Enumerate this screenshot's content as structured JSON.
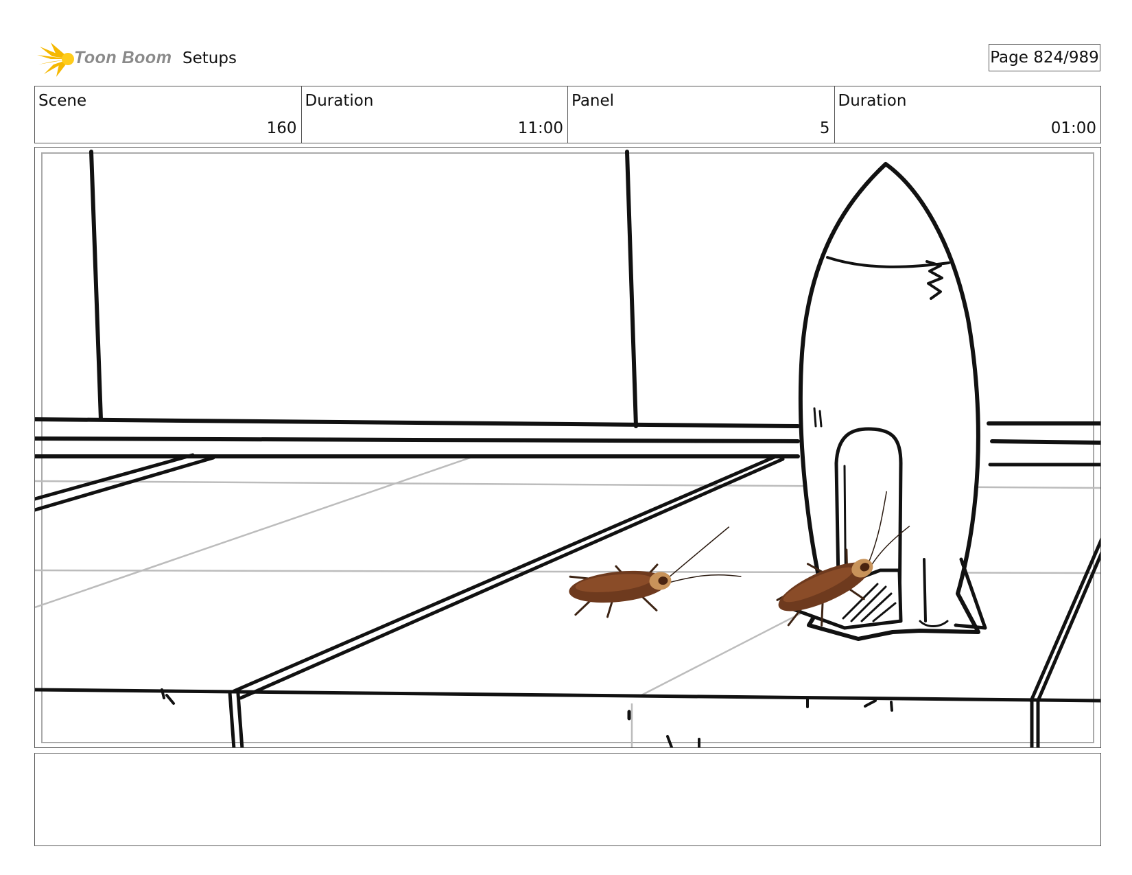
{
  "header": {
    "brand": "Toon Boom",
    "section_title": "Setups",
    "page_indicator": "Page 824/989",
    "brand_color": "#f5b800"
  },
  "info": [
    {
      "label": "Scene",
      "value": "160"
    },
    {
      "label": "Duration",
      "value": "11:00"
    },
    {
      "label": "Panel",
      "value": "5"
    },
    {
      "label": "Duration",
      "value": "01:00"
    }
  ],
  "panel": {
    "subject_icons": [
      "rocket-drawing",
      "cockroach-icon",
      "cockroach-icon"
    ]
  },
  "notes": {
    "text": ""
  }
}
